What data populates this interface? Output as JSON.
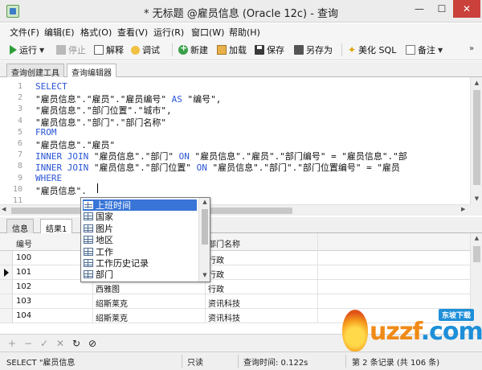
{
  "window": {
    "title": "* 无标题 @雇员信息 (Oracle 12c) - 查询",
    "minimize": "—",
    "maximize": "☐",
    "close": "✕"
  },
  "menu": [
    "文件(F)",
    "编辑(E)",
    "格式(O)",
    "查看(V)",
    "运行(R)",
    "窗口(W)",
    "帮助(H)"
  ],
  "toolbar": {
    "run": "运行",
    "stop": "停止",
    "explain": "解释",
    "debug": "调试",
    "new": "新建",
    "load": "加载",
    "save": "保存",
    "save_as": "另存为",
    "beautify": "美化 SQL",
    "note": "备注",
    "more": "»"
  },
  "editor_tabs": [
    "查询创建工具",
    "查询编辑器"
  ],
  "editor": {
    "line_numbers": [
      "1",
      "2",
      "3",
      "4",
      "5",
      "6",
      "7",
      "8",
      "9",
      "10",
      "11"
    ],
    "lines": [
      [
        {
          "t": "SELECT",
          "k": true
        }
      ],
      [
        {
          "t": "\"雇员信息\".\"雇员\".\"雇员编号\" ",
          "k": false
        },
        {
          "t": "AS",
          "k": true
        },
        {
          "t": " \"编号\",",
          "k": false
        }
      ],
      [
        {
          "t": "\"雇员信息\".\"部门位置\".\"城市\",",
          "k": false
        }
      ],
      [
        {
          "t": "\"雇员信息\".\"部门\".\"部门名称\"",
          "k": false
        }
      ],
      [
        {
          "t": "FROM",
          "k": true
        }
      ],
      [
        {
          "t": "\"雇员信息\".\"雇员\"",
          "k": false
        }
      ],
      [
        {
          "t": "INNER JOIN",
          "k": true
        },
        {
          "t": " \"雇员信息\".\"部门\" ",
          "k": false
        },
        {
          "t": "ON",
          "k": true
        },
        {
          "t": " \"雇员信息\".\"雇员\".\"部门编号\" = \"雇员信息\".\"部",
          "k": false
        }
      ],
      [
        {
          "t": "INNER JOIN",
          "k": true
        },
        {
          "t": " \"雇员信息\".\"部门位置\" ",
          "k": false
        },
        {
          "t": "ON",
          "k": true
        },
        {
          "t": " \"雇员信息\".\"部门\".\"部门位置编号\" = \"雇员",
          "k": false
        }
      ],
      [
        {
          "t": "WHERE",
          "k": true
        }
      ],
      [
        {
          "t": "\"雇员信息\".",
          "k": false
        }
      ],
      []
    ]
  },
  "autocomplete": {
    "items": [
      "上班时间",
      "国家",
      "图片",
      "地区",
      "工作",
      "工作历史记录",
      "部门"
    ],
    "selected_index": 0
  },
  "result_tabs": [
    "信息",
    "结果1"
  ],
  "grid": {
    "columns": [
      "编号",
      "城市",
      "部门名称"
    ],
    "rows": [
      [
        "100",
        "",
        "行政"
      ],
      [
        "101",
        "",
        "行政"
      ],
      [
        "102",
        "西雅图",
        "行政"
      ],
      [
        "103",
        "绍斯莱克",
        "资讯科技"
      ],
      [
        "104",
        "绍斯莱克",
        "资讯科技"
      ]
    ],
    "current_row": 1
  },
  "navigation": [
    "+",
    "−",
    "✓",
    "✕",
    "↻",
    "⊘"
  ],
  "status": {
    "sql": "SELECT \"雇员信息",
    "mode": "只读",
    "query_time": "查询时间: 0.122s",
    "records": "第 2 条记录 (共 106 条)"
  },
  "watermark": {
    "text": "uzzf",
    "domain": ".com",
    "badge": "东坡下载"
  },
  "colors": {
    "keyword": "#2a55d6",
    "selection": "#3875d7",
    "close_button": "#c9413a"
  }
}
